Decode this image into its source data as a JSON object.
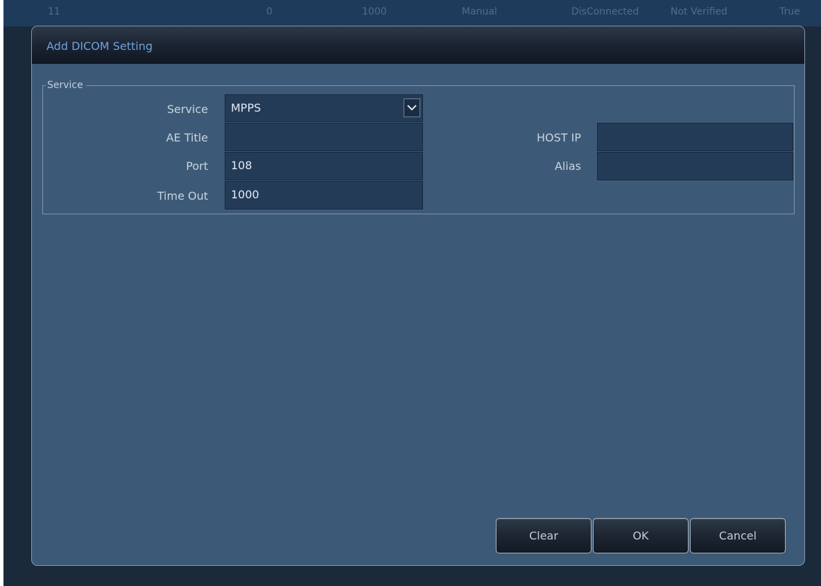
{
  "background_row": {
    "cells": [
      "11",
      "0",
      "1000",
      "Manual",
      "DisConnected",
      "Not Verified",
      "True"
    ]
  },
  "dialog": {
    "title": "Add DICOM Setting",
    "group_title": "Service",
    "fields": {
      "service": {
        "label": "Service",
        "value": "MPPS"
      },
      "ae_title": {
        "label": "AE Title",
        "value": ""
      },
      "port": {
        "label": "Port",
        "value": "108"
      },
      "time_out": {
        "label": "Time Out",
        "value": "1000"
      },
      "host_ip": {
        "label": "HOST IP",
        "value": ""
      },
      "alias": {
        "label": "Alias",
        "value": ""
      }
    },
    "buttons": {
      "clear": "Clear",
      "ok": "OK",
      "cancel": "Cancel"
    }
  },
  "icons": {
    "dropdown": "chevron-down-icon"
  },
  "colors": {
    "dialog_background": "#3c5a77",
    "title_text": "#6ea3dc",
    "field_background": "#243b58",
    "header_dark": "#1a2230"
  }
}
